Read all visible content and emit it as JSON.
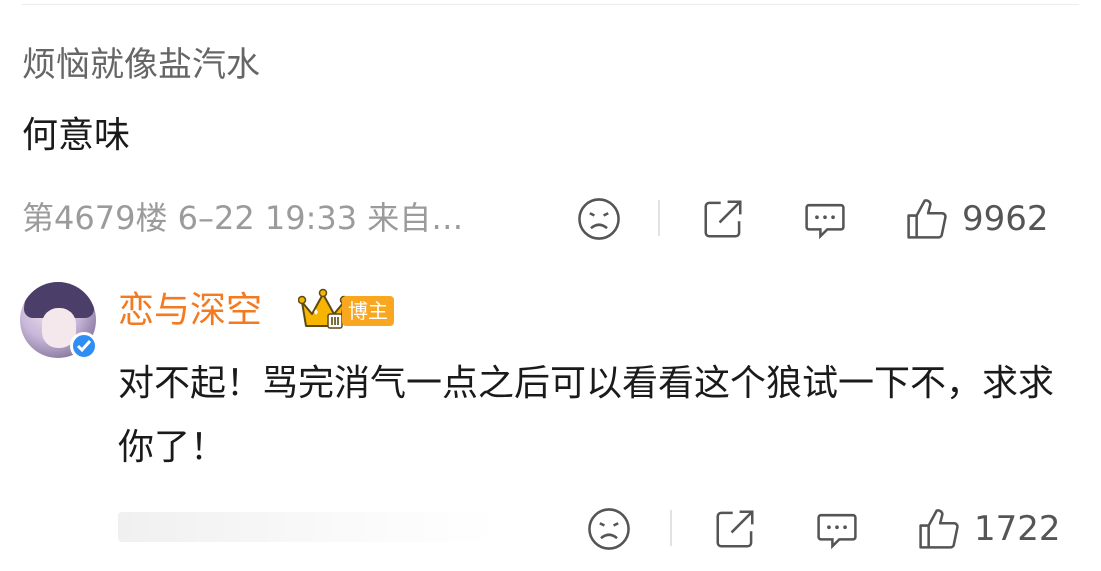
{
  "comment": {
    "sub_text": "烦恼就像盐汽水",
    "text": "何意味",
    "meta": "第4679楼 6–22 19:33 来自…",
    "like_count": "9962"
  },
  "reply": {
    "username": "恋与深空",
    "badge": "博主",
    "text": "对不起！骂完消气一点之后可以看看这个狼试一下不，求求你了！",
    "like_count": "1722"
  },
  "icons": {
    "dislike": "sad-face-icon",
    "share": "share-icon",
    "comment": "comment-icon",
    "like": "thumbs-up-icon",
    "verified": "verified-check-icon",
    "crown": "crown-icon"
  },
  "colors": {
    "username": "#f5791f",
    "badge": "#f9a620",
    "verified": "#2f8ef4",
    "meta": "#9b9b9b"
  }
}
